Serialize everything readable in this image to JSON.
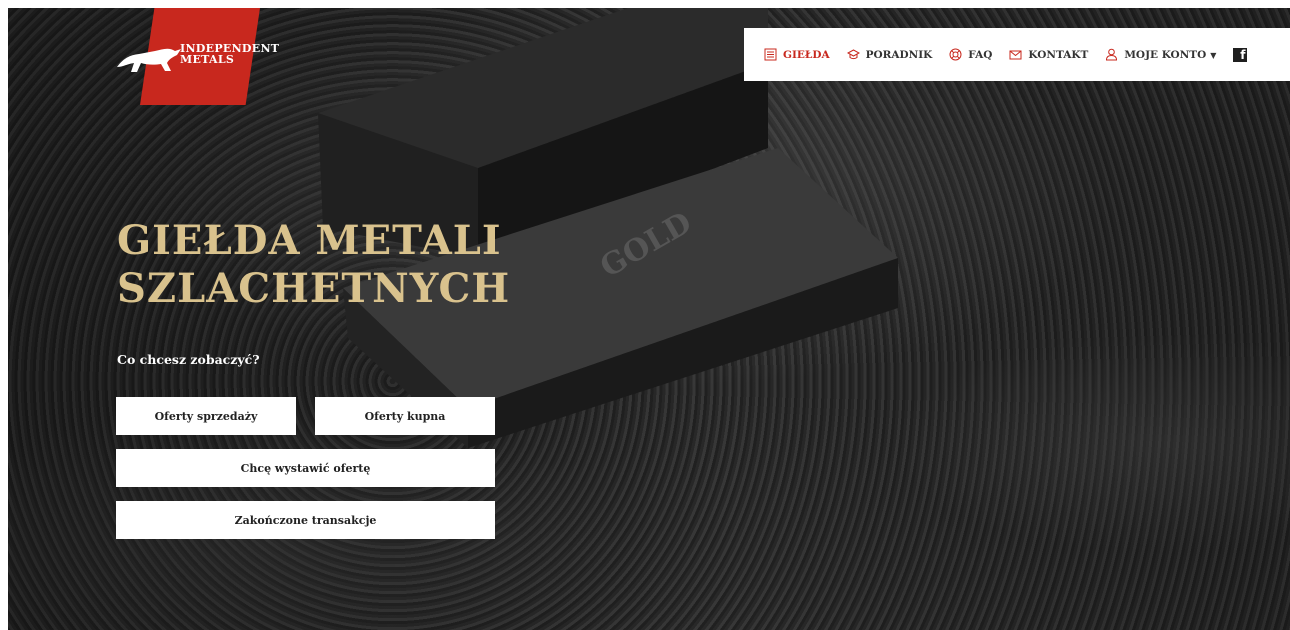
{
  "brand": {
    "logo_line1": "INDEPENDENT",
    "logo_line2": "METALS",
    "accent_color": "#c8281e"
  },
  "nav": {
    "items": [
      {
        "label": "GIEŁDA",
        "icon": "list-icon",
        "active": true
      },
      {
        "label": "PORADNIK",
        "icon": "graduation-cap-icon",
        "active": false
      },
      {
        "label": "FAQ",
        "icon": "lifebuoy-icon",
        "active": false
      },
      {
        "label": "KONTAKT",
        "icon": "envelope-icon",
        "active": false
      },
      {
        "label": "MOJE KONTO",
        "icon": "user-icon",
        "active": false
      }
    ],
    "social_icon": "facebook-icon"
  },
  "hero": {
    "headline_line1": "GIEŁDA METALI",
    "headline_line2": "SZLACHETNYCH",
    "headline_color": "#d9c28d",
    "question": "Co chcesz zobaczyć?",
    "buttons": {
      "sell_offers": "Oferty sprzedaży",
      "buy_offers": "Oferty kupna",
      "create_offer": "Chcę wystawić ofertę",
      "closed_transactions": "Zakończone transakcje"
    }
  }
}
